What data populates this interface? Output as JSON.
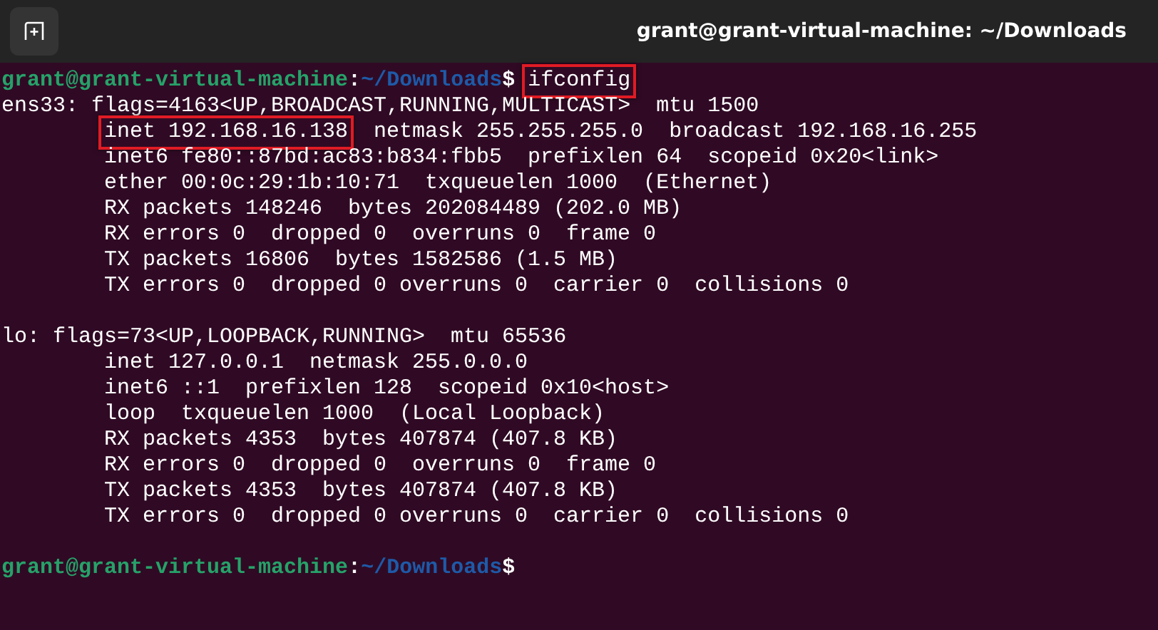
{
  "window": {
    "title": "grant@grant-virtual-machine: ~/Downloads"
  },
  "terminal": {
    "lines": [
      {
        "kind": "prompt",
        "prompt": [
          {
            "text": "grant@grant-virtual-machine",
            "color": "#26a269"
          },
          {
            "text": ":",
            "color": "#ffffff"
          },
          {
            "text": "~/Downloads",
            "color": "#1e5aa8"
          },
          {
            "text": "$",
            "color": "#ffffff"
          }
        ],
        "command": {
          "text": "ifconfig",
          "highlighted": true
        }
      },
      {
        "kind": "output",
        "indented": false,
        "parts": [
          {
            "text": "ens33: flags=4163<UP,BROADCAST,RUNNING,MULTICAST>  mtu 1500",
            "highlighted": false
          }
        ]
      },
      {
        "kind": "output",
        "indented": true,
        "parts": [
          {
            "text": "inet 192.168.16.138",
            "highlighted": true
          },
          {
            "text": "netmask 255.255.255.0  broadcast 192.168.16.255",
            "highlighted": false
          }
        ]
      },
      {
        "kind": "output",
        "indented": true,
        "parts": [
          {
            "text": "inet6 fe80::87bd:ac83:b834:fbb5  prefixlen 64  scopeid 0x20<link>",
            "highlighted": false
          }
        ]
      },
      {
        "kind": "output",
        "indented": true,
        "parts": [
          {
            "text": "ether 00:0c:29:1b:10:71  txqueuelen 1000  (Ethernet)",
            "highlighted": false
          }
        ]
      },
      {
        "kind": "output",
        "indented": true,
        "parts": [
          {
            "text": "RX packets 148246  bytes 202084489 (202.0 MB)",
            "highlighted": false
          }
        ]
      },
      {
        "kind": "output",
        "indented": true,
        "parts": [
          {
            "text": "RX errors 0  dropped 0  overruns 0  frame 0",
            "highlighted": false
          }
        ]
      },
      {
        "kind": "output",
        "indented": true,
        "parts": [
          {
            "text": "TX packets 16806  bytes 1582586 (1.5 MB)",
            "highlighted": false
          }
        ]
      },
      {
        "kind": "output",
        "indented": true,
        "parts": [
          {
            "text": "TX errors 0  dropped 0 overruns 0  carrier 0  collisions 0",
            "highlighted": false
          }
        ]
      },
      {
        "kind": "blank"
      },
      {
        "kind": "output",
        "indented": false,
        "parts": [
          {
            "text": "lo: flags=73<UP,LOOPBACK,RUNNING>  mtu 65536",
            "highlighted": false
          }
        ]
      },
      {
        "kind": "output",
        "indented": true,
        "parts": [
          {
            "text": "inet 127.0.0.1  netmask 255.0.0.0",
            "highlighted": false
          }
        ]
      },
      {
        "kind": "output",
        "indented": true,
        "parts": [
          {
            "text": "inet6 ::1  prefixlen 128  scopeid 0x10<host>",
            "highlighted": false
          }
        ]
      },
      {
        "kind": "output",
        "indented": true,
        "parts": [
          {
            "text": "loop  txqueuelen 1000  (Local Loopback)",
            "highlighted": false
          }
        ]
      },
      {
        "kind": "output",
        "indented": true,
        "parts": [
          {
            "text": "RX packets 4353  bytes 407874 (407.8 KB)",
            "highlighted": false
          }
        ]
      },
      {
        "kind": "output",
        "indented": true,
        "parts": [
          {
            "text": "RX errors 0  dropped 0  overruns 0  frame 0",
            "highlighted": false
          }
        ]
      },
      {
        "kind": "output",
        "indented": true,
        "parts": [
          {
            "text": "TX packets 4353  bytes 407874 (407.8 KB)",
            "highlighted": false
          }
        ]
      },
      {
        "kind": "output",
        "indented": true,
        "parts": [
          {
            "text": "TX errors 0  dropped 0 overruns 0  carrier 0  collisions 0",
            "highlighted": false
          }
        ]
      },
      {
        "kind": "blank"
      },
      {
        "kind": "prompt",
        "prompt": [
          {
            "text": "grant@grant-virtual-machine",
            "color": "#26a269"
          },
          {
            "text": ":",
            "color": "#ffffff"
          },
          {
            "text": "~/Downloads",
            "color": "#1e5aa8"
          },
          {
            "text": "$",
            "color": "#ffffff"
          }
        ]
      }
    ]
  }
}
